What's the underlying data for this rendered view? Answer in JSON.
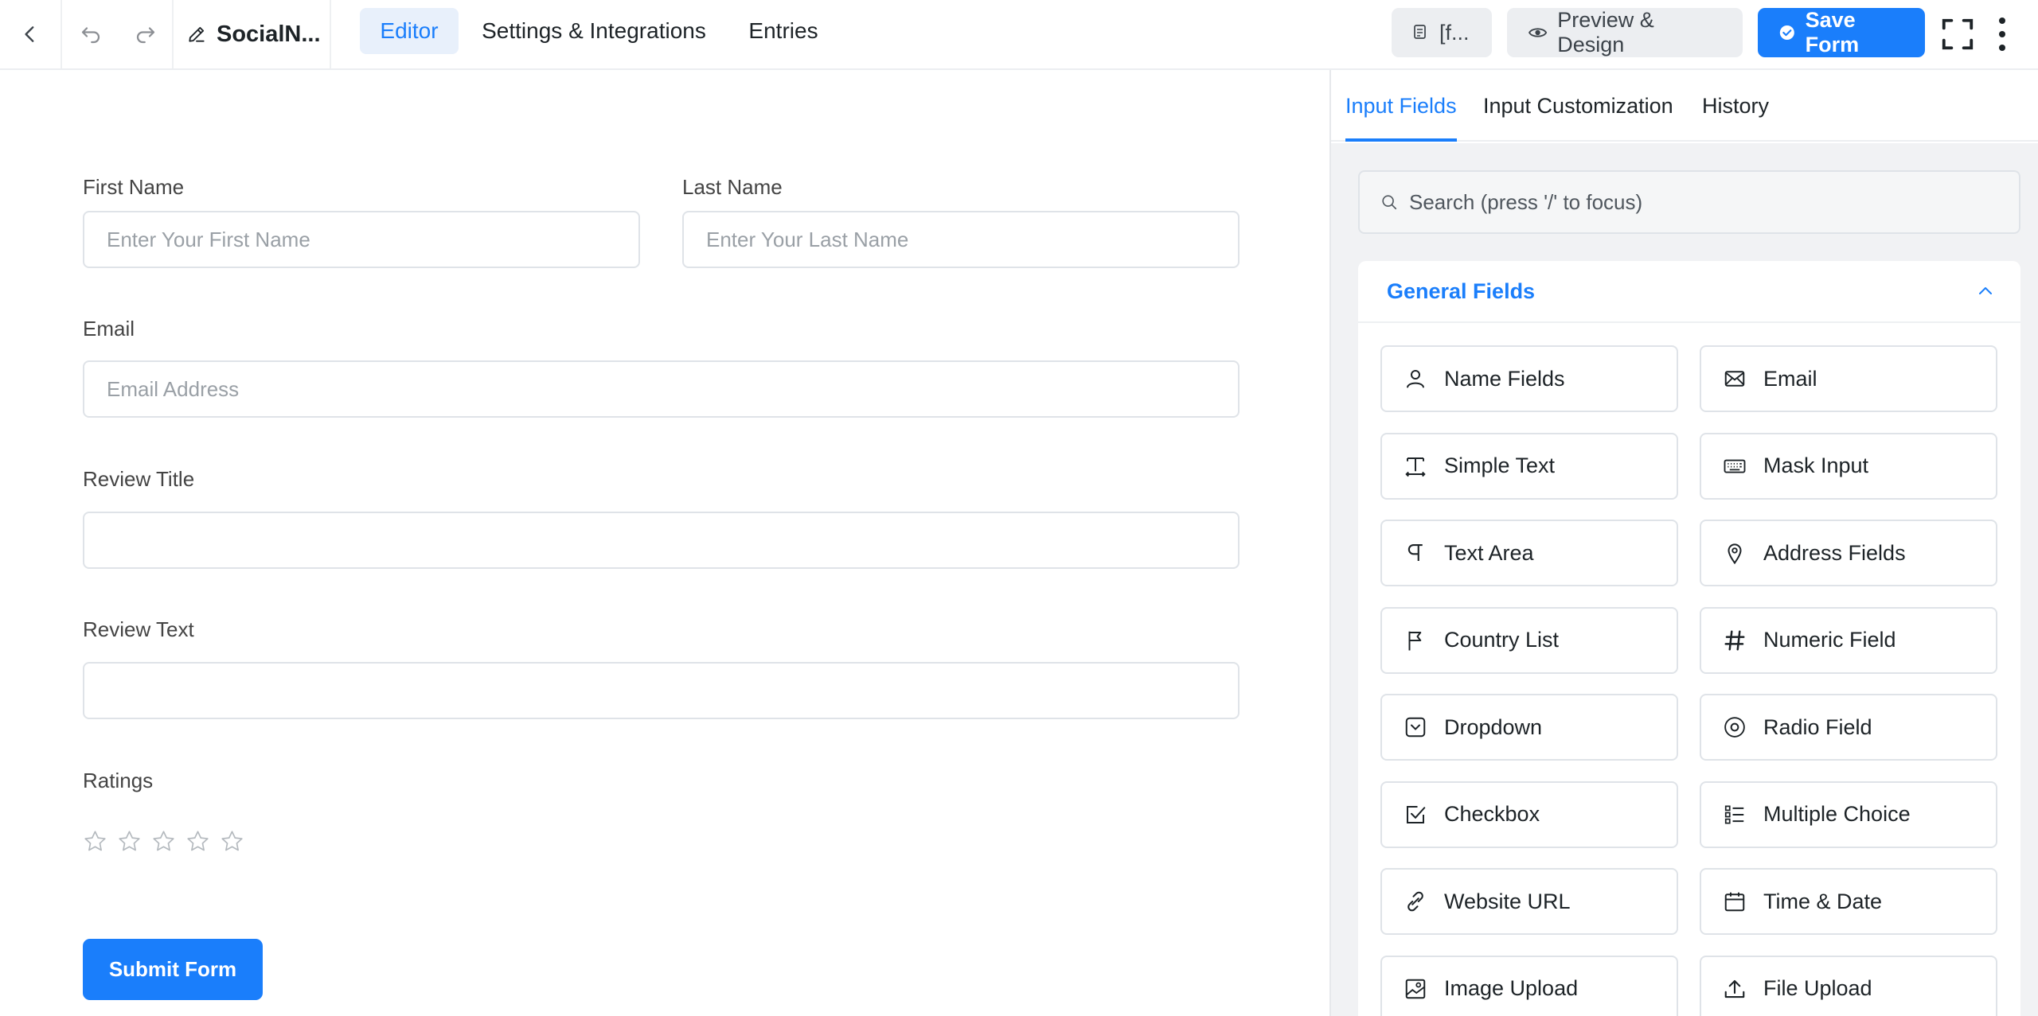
{
  "toolbar": {
    "form_name": "SocialN...",
    "tabs": [
      {
        "label": "Editor",
        "active": true
      },
      {
        "label": "Settings & Integrations",
        "active": false
      },
      {
        "label": "Entries",
        "active": false
      }
    ],
    "shortcode_label": "[f...",
    "preview_label": "Preview & Design",
    "save_label": "Save Form"
  },
  "form": {
    "first_name": {
      "label": "First Name",
      "placeholder": "Enter Your First Name"
    },
    "last_name": {
      "label": "Last Name",
      "placeholder": "Enter Your Last Name"
    },
    "email": {
      "label": "Email",
      "placeholder": "Email Address"
    },
    "review_title": {
      "label": "Review Title",
      "placeholder": ""
    },
    "review_text": {
      "label": "Review Text",
      "placeholder": ""
    },
    "ratings": {
      "label": "Ratings",
      "max_stars": 5,
      "value": 0
    },
    "submit_label": "Submit Form"
  },
  "panel": {
    "tabs": [
      {
        "label": "Input Fields",
        "active": true
      },
      {
        "label": "Input Customization",
        "active": false
      },
      {
        "label": "History",
        "active": false
      }
    ],
    "search_placeholder": "Search (press '/' to focus)",
    "section_title": "General Fields",
    "fields": [
      {
        "label": "Name Fields",
        "icon": "user-icon"
      },
      {
        "label": "Email",
        "icon": "envelope-icon"
      },
      {
        "label": "Simple Text",
        "icon": "text-cursor-icon"
      },
      {
        "label": "Mask Input",
        "icon": "keyboard-icon"
      },
      {
        "label": "Text Area",
        "icon": "paragraph-icon"
      },
      {
        "label": "Address Fields",
        "icon": "map-pin-icon"
      },
      {
        "label": "Country List",
        "icon": "flag-icon"
      },
      {
        "label": "Numeric Field",
        "icon": "hash-icon"
      },
      {
        "label": "Dropdown",
        "icon": "dropdown-icon"
      },
      {
        "label": "Radio Field",
        "icon": "radio-icon"
      },
      {
        "label": "Checkbox",
        "icon": "checkbox-icon"
      },
      {
        "label": "Multiple Choice",
        "icon": "list-icon"
      },
      {
        "label": "Website URL",
        "icon": "link-icon"
      },
      {
        "label": "Time & Date",
        "icon": "calendar-icon"
      },
      {
        "label": "Image Upload",
        "icon": "image-icon"
      },
      {
        "label": "File Upload",
        "icon": "upload-icon"
      }
    ]
  },
  "colors": {
    "accent": "#1a7efb",
    "border": "#dfe3e8",
    "panel_bg": "#f1f2f4"
  }
}
